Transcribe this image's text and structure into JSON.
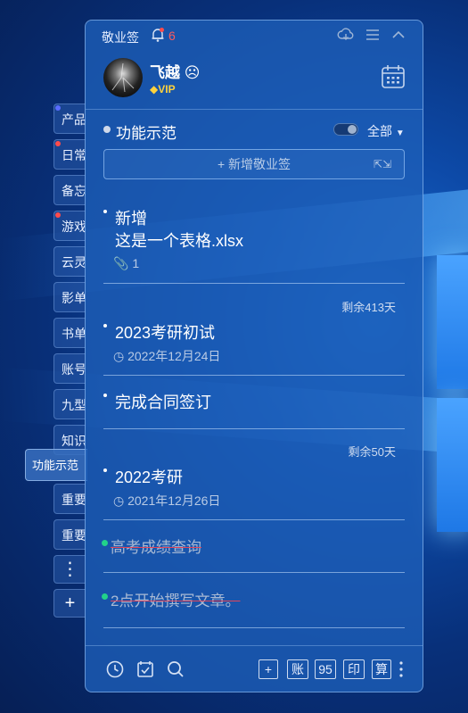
{
  "side_tabs": [
    {
      "label": "产品",
      "dot": "#5a6cff"
    },
    {
      "label": "日常",
      "dot": "#ff4b4b"
    },
    {
      "label": "备忘",
      "dot": ""
    },
    {
      "label": "游戏",
      "dot": "#ff4b4b"
    },
    {
      "label": "云灵",
      "dot": ""
    },
    {
      "label": "影单",
      "dot": ""
    },
    {
      "label": "书单",
      "dot": ""
    },
    {
      "label": "账号",
      "dot": ""
    },
    {
      "label": "九型",
      "dot": ""
    },
    {
      "label": "知识",
      "dot": ""
    }
  ],
  "active_tab": "功能示范",
  "side_tabs_lower": [
    "重要",
    "重要"
  ],
  "side_more_glyph": "⋮",
  "side_add_glyph": "+",
  "app_title": "敬业签",
  "bell_count": "6",
  "user": {
    "name": "飞越",
    "vip": "VIP"
  },
  "section": {
    "title": "功能示范",
    "filter": "全部"
  },
  "add_button": "+ 新增敬业签",
  "notes": [
    {
      "lines": [
        "新增",
        "这是一个表格.xlsx"
      ],
      "attachment": "1"
    },
    {
      "remain": "剩余413天",
      "text": "2023考研初试",
      "date": "2022年12月24日"
    },
    {
      "text": "完成合同签订"
    },
    {
      "remain": "剩余50天",
      "text": "2022考研",
      "date": "2021年12月26日"
    },
    {
      "text": "高考成绩查询",
      "done": true
    },
    {
      "text": "2点开始撰写文章。",
      "done": true
    }
  ],
  "bottom_buttons": [
    "账",
    "95",
    "印",
    "算"
  ],
  "colors": {
    "accent_red": "#ff5a5a",
    "done_green": "#22d28a",
    "vip_gold": "#ffd23c"
  }
}
